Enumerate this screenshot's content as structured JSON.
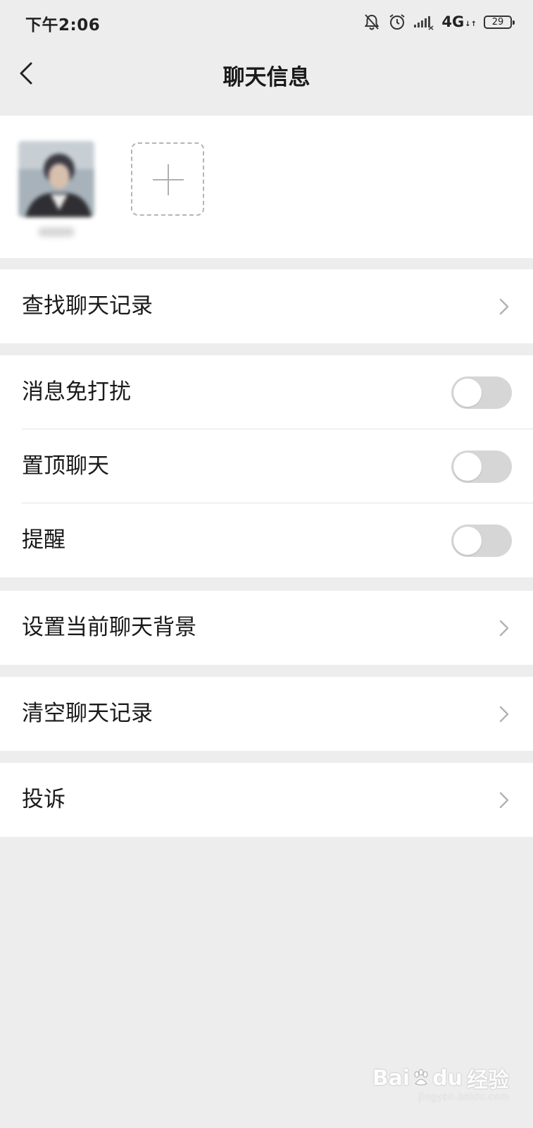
{
  "status_bar": {
    "time": "下午2:06",
    "network": "4G",
    "network_arrows": "↓↑",
    "battery": "29",
    "icons": [
      "bell-muted-icon",
      "alarm-icon",
      "signal-icon",
      "battery-icon"
    ]
  },
  "nav": {
    "title": "聊天信息",
    "back_icon": "chevron-left-icon"
  },
  "members": {
    "add_icon": "plus-icon"
  },
  "groups": [
    {
      "items": [
        {
          "label": "查找聊天记录",
          "type": "link"
        }
      ]
    },
    {
      "items": [
        {
          "label": "消息免打扰",
          "type": "toggle",
          "on": false
        },
        {
          "label": "置顶聊天",
          "type": "toggle",
          "on": false
        },
        {
          "label": "提醒",
          "type": "toggle",
          "on": false
        }
      ]
    },
    {
      "items": [
        {
          "label": "设置当前聊天背景",
          "type": "link"
        }
      ]
    },
    {
      "items": [
        {
          "label": "清空聊天记录",
          "type": "link"
        }
      ]
    },
    {
      "items": [
        {
          "label": "投诉",
          "type": "link"
        }
      ]
    }
  ],
  "watermark": {
    "brand": "Bai",
    "brand_suffix": "du",
    "product": "经验",
    "url": "jingyan.baidu.com"
  },
  "colors": {
    "background": "#ededed",
    "surface": "#ffffff",
    "toggle_off": "#d6d6d6",
    "text": "#1a1a1a",
    "chevron": "#b2b2b2"
  }
}
